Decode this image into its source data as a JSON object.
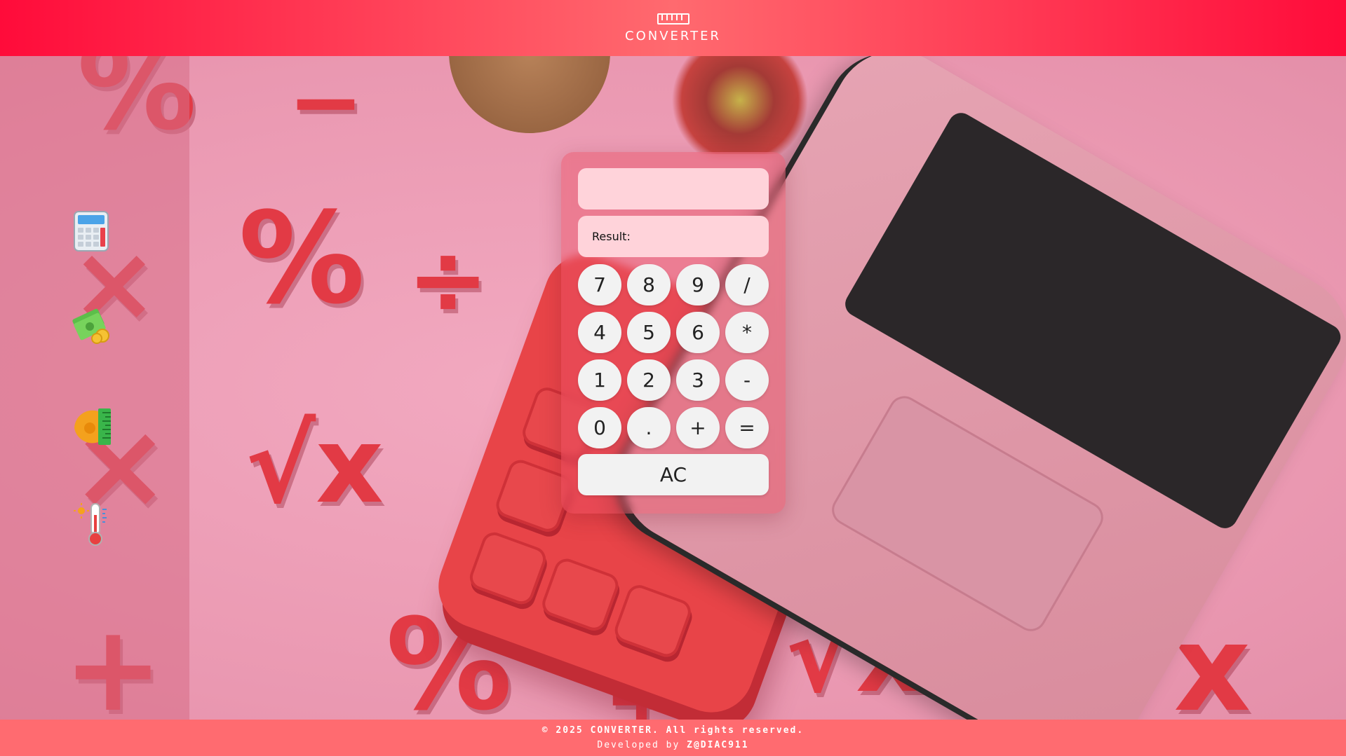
{
  "header": {
    "brand": "CONVERTER",
    "logo_icon": "ruler-icon"
  },
  "sidebar": {
    "items": [
      {
        "icon": "calculator-icon",
        "label": "Calculator"
      },
      {
        "icon": "currency-icon",
        "label": "Currency"
      },
      {
        "icon": "length-measure-icon",
        "label": "Length"
      },
      {
        "icon": "temperature-icon",
        "label": "Temperature"
      }
    ]
  },
  "calculator": {
    "input_value": "",
    "result_label": "Result:",
    "result_value": "",
    "keys": [
      "7",
      "8",
      "9",
      "/",
      "4",
      "5",
      "6",
      "*",
      "1",
      "2",
      "3",
      "-",
      "0",
      ".",
      "+",
      "="
    ],
    "clear_label": "AC"
  },
  "footer": {
    "copyright": "© 2025 CONVERTER. All rights reserved.",
    "developed_prefix": "Developed by",
    "developer": "Z@DIAC911"
  },
  "colors": {
    "header": "#ff0b3a",
    "footer": "#ff6b70",
    "display": "#ffd3da",
    "key": "#f2f2f2"
  }
}
